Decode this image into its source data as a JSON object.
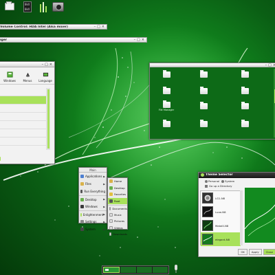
{
  "colors": {
    "accent": "#a8e15a",
    "wallpaper": "#128a1f",
    "window_bg": "#f2f2f2"
  },
  "shelf": {
    "folder_icon": "folder-icon",
    "meter": {
      "line1": "8kV",
      "line2": "8kV"
    },
    "sliders_icon": "sliders-icon",
    "camera_icon": "camera-icon"
  },
  "mixer_bar": {
    "title": "Volume Control: HDA Intel (Alsa mixer)",
    "buttons": [
      "–",
      "□",
      "×"
    ]
  },
  "second_bar": {
    "title": "iger",
    "buttons": [
      "–",
      "□",
      "×"
    ]
  },
  "settings_window": {
    "title": "",
    "buttons": [
      "–",
      "□",
      "×"
    ],
    "toolbar": [
      {
        "label": "Windows",
        "icon": "windows-icon"
      },
      {
        "label": "Menus",
        "icon": "menus-icon"
      },
      {
        "label": "Language",
        "icon": "language-icon"
      }
    ],
    "selected_row": 1
  },
  "file_manager": {
    "buttons": [
      "–",
      "□",
      "×"
    ],
    "items": [
      "",
      "",
      "",
      "",
      "File Manager",
      "",
      "",
      "",
      "",
      "",
      "",
      ""
    ]
  },
  "desktop_menu": {
    "title": "Main",
    "items": [
      {
        "label": "Applications",
        "icon": "applications-icon",
        "arrow": "▶"
      },
      {
        "label": "Files",
        "icon": "files-icon",
        "arrow": "▶"
      },
      {
        "label": "Run Everything",
        "icon": "run-icon",
        "arrow": ""
      },
      {
        "label": "Desktop",
        "icon": "desktop-icon",
        "arrow": "▶"
      },
      {
        "label": "Windows",
        "icon": "windows-icon",
        "arrow": "▶"
      },
      {
        "label": "Enlightenment",
        "icon": "enlightenment-icon",
        "arrow": "▶"
      },
      {
        "label": "Settings",
        "icon": "settings-icon",
        "arrow": "▶"
      },
      {
        "label": "System",
        "icon": "system-icon",
        "arrow": "▶"
      }
    ]
  },
  "files_submenu": {
    "items": [
      "Home",
      "Desktop",
      "Favorites",
      "Root",
      "Documents",
      "Music",
      "Pictures",
      "Videos",
      "Downloads"
    ],
    "highlighted": 3
  },
  "theme_selector": {
    "title": "Theme Selector",
    "tabs": [
      "Personal",
      "System"
    ],
    "breadcrumb": "Go up a Directory",
    "themes": [
      "LG1-N8",
      "Luxe-N8",
      "Mataill-N8",
      "elegant-N8"
    ],
    "selected": 3,
    "buttons": [
      "OK",
      "Apply",
      "Close"
    ]
  },
  "pager": {
    "desks": 4,
    "active": 0
  },
  "mic_icon": "microphone-icon"
}
